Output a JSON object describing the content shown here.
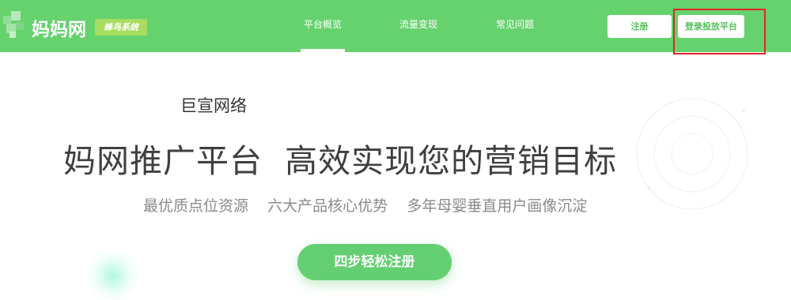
{
  "header": {
    "logo_text": "妈妈网",
    "logo_badge": "蜂鸟系统",
    "nav": [
      {
        "label": "平台概览",
        "active": true
      },
      {
        "label": "流量变现",
        "active": false
      },
      {
        "label": "常见问题",
        "active": false
      }
    ],
    "register_label": "注册",
    "login_label": "登录投放平台"
  },
  "hero": {
    "company": "巨宣网络",
    "headline": "妈网推广平台  高效实现您的营销目标",
    "subline": "最优质点位资源    六大产品核心优势    多年母婴垂直用户画像沉淀",
    "cta_label": "四步轻松注册"
  },
  "colors": {
    "brand_green": "#66d26e",
    "badge_green": "#a7dd60",
    "cta_green": "#64cf72",
    "highlight_red": "#e02424"
  }
}
